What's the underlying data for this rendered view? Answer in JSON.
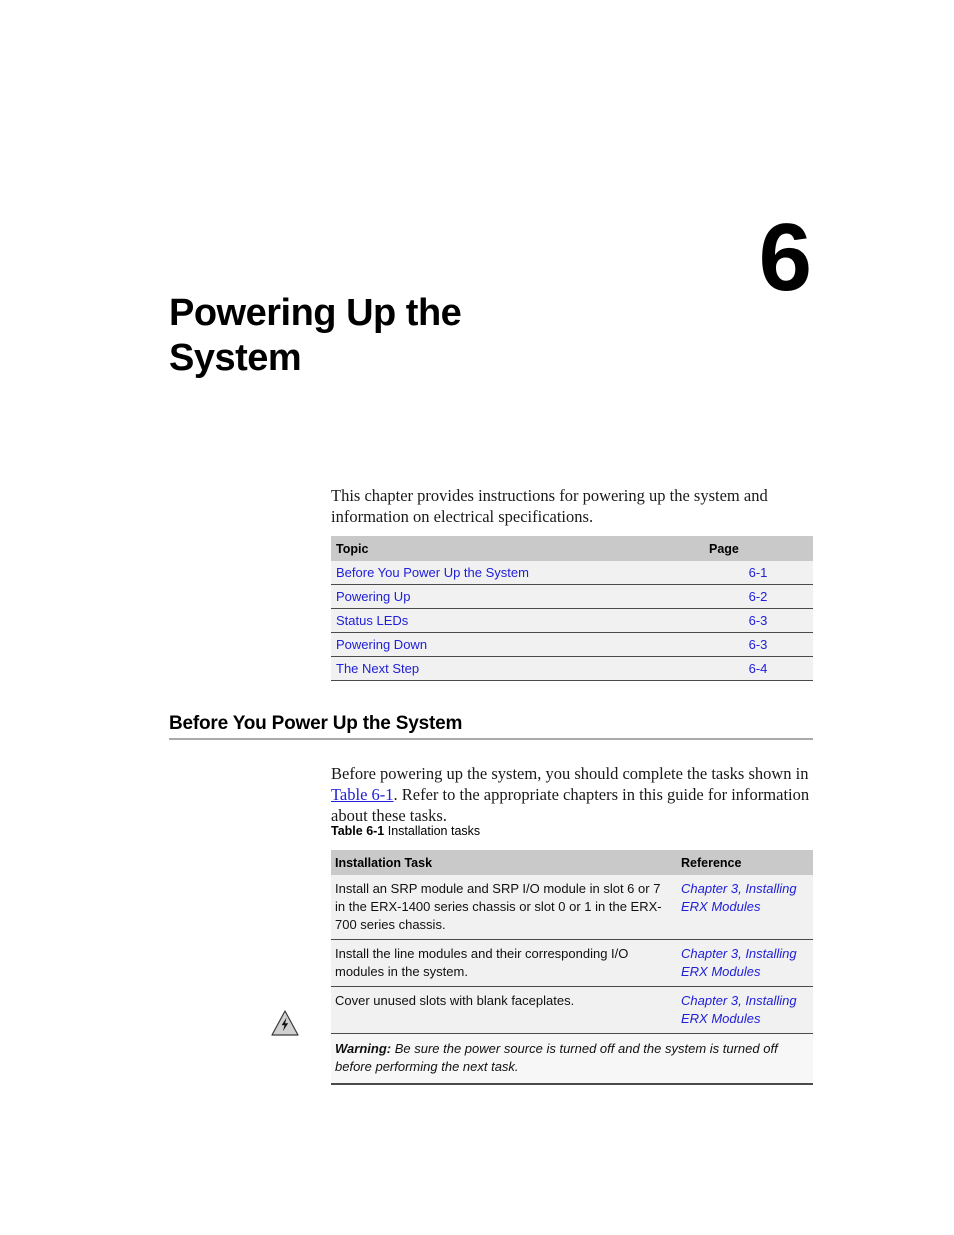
{
  "chapter": {
    "number": "6",
    "title": "Powering Up the\nSystem",
    "title_line1": "Powering Up the",
    "title_line2": "System"
  },
  "intro": {
    "paragraph": "This chapter provides instructions for powering up the system and information on electrical specifications."
  },
  "topics_table": {
    "headers": {
      "topic": "Topic",
      "page": "Page"
    },
    "rows": [
      {
        "topic": "Before You Power Up the System",
        "page": "6-1"
      },
      {
        "topic": "Powering Up",
        "page": "6-2"
      },
      {
        "topic": "Status LEDs",
        "page": "6-3"
      },
      {
        "topic": "Powering Down",
        "page": "6-3"
      },
      {
        "topic": "The Next Step",
        "page": "6-4"
      }
    ]
  },
  "section": {
    "heading": "Before You Power Up the System",
    "paragraph_part1": "Before powering up the system, you should complete the tasks shown in ",
    "paragraph_link": "Table 6-1",
    "paragraph_part2": ". Refer to the appropriate chapters in this guide for information about these tasks."
  },
  "tasks_table": {
    "caption_label": "Table 6-1",
    "caption_text": "Installation tasks",
    "headers": {
      "task": "Installation Task",
      "reference": "Reference"
    },
    "rows": [
      {
        "task": "Install an SRP module and SRP I/O module in slot 6 or 7 in the ERX-1400 series chassis or slot 0 or 1 in the ERX-700 series chassis.",
        "reference": "Chapter 3, Installing ERX Modules"
      },
      {
        "task": "Install the line modules and their corresponding I/O modules in the system.",
        "reference": "Chapter 3, Installing ERX Modules"
      },
      {
        "task": "Cover unused slots with blank faceplates.",
        "reference": "Chapter 3, Installing ERX Modules"
      }
    ],
    "warning": {
      "label": "Warning:",
      "text": " Be sure the power source is turned off and the system is turned off before performing the next task."
    },
    "warning_icon_name": "electrical-hazard-warning-icon"
  },
  "colors": {
    "link": "#2020d8",
    "table_header_bg": "#c9c9c9",
    "table_row_bg": "#f1f1f1",
    "rule": "#a9a9a9",
    "text": "#111111"
  }
}
